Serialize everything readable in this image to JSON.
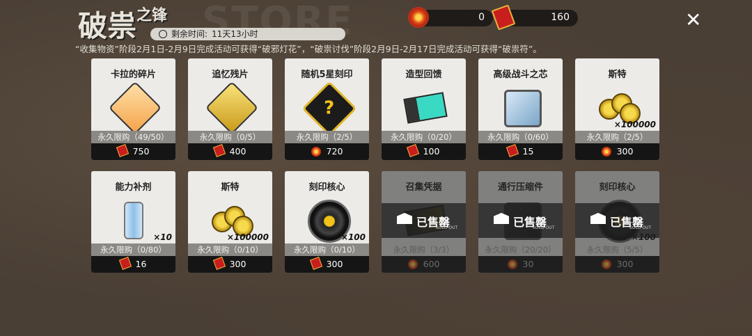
{
  "header": {
    "bg_word": "STORE",
    "title_main": "破祟",
    "title_small": "之锋",
    "timer_label": "剩余时间:",
    "timer_value": "11天13小时",
    "notice": "“收集物资”阶段2月1日-2月9日完成活动可获得“破邪灯花”，“破祟讨伐”阶段2月9日-2月17日完成活动可获得“破祟符”。"
  },
  "currency": [
    {
      "name": "破邪灯花",
      "icon": "flower-icon",
      "value": "0"
    },
    {
      "name": "破祟符",
      "icon": "talisman-icon",
      "value": "160"
    }
  ],
  "close_label": "✕",
  "colors": {
    "talisman": "#c81e1e",
    "flower": "#e04a1a",
    "card_bg": "#ecebe8"
  },
  "items": [
    {
      "name": "卡拉的碎片",
      "limit": "永久限购（49/50）",
      "price": "750",
      "currency": "talisman",
      "qty": "",
      "sold": false,
      "art": "portrait-shard"
    },
    {
      "name": "追忆残片",
      "limit": "永久限购（0/5）",
      "price": "400",
      "currency": "talisman",
      "qty": "",
      "sold": false,
      "art": "gold-shard"
    },
    {
      "name": "随机5星刻印",
      "limit": "永久限购（2/5）",
      "price": "720",
      "currency": "flower",
      "qty": "",
      "sold": false,
      "art": "mystery-seal"
    },
    {
      "name": "造型回馈",
      "limit": "永久限购（0/20）",
      "price": "100",
      "currency": "talisman",
      "qty": "",
      "sold": false,
      "art": "ticket"
    },
    {
      "name": "高级战斗之芯",
      "limit": "永久限购（0/60）",
      "price": "15",
      "currency": "talisman",
      "qty": "",
      "sold": false,
      "art": "crystal-cube"
    },
    {
      "name": "斯特",
      "limit": "永久限购（2/5）",
      "price": "300",
      "currency": "flower",
      "qty": "×100000",
      "sold": false,
      "art": "coins"
    },
    {
      "name": "能力补剂",
      "limit": "永久限购（0/80）",
      "price": "16",
      "currency": "talisman",
      "qty": "×10",
      "sold": false,
      "art": "vial"
    },
    {
      "name": "斯特",
      "limit": "永久限购（0/10）",
      "price": "300",
      "currency": "talisman",
      "qty": "×100000",
      "sold": false,
      "art": "coins"
    },
    {
      "name": "刻印核心",
      "limit": "永久限购（0/10）",
      "price": "300",
      "currency": "talisman",
      "qty": "×100",
      "sold": false,
      "art": "core"
    },
    {
      "name": "召集凭据",
      "limit": "永久限购（3/3）",
      "price": "600",
      "currency": "flower",
      "qty": "",
      "sold": true,
      "art": "voucher"
    },
    {
      "name": "通行压缩件",
      "limit": "永久限购（20/20）",
      "price": "30",
      "currency": "flower",
      "qty": "",
      "sold": true,
      "art": "device"
    },
    {
      "name": "刻印核心",
      "limit": "永久限购（5/5）",
      "price": "300",
      "currency": "flower",
      "qty": "×100",
      "sold": true,
      "art": "core"
    }
  ],
  "sold_label": "已售罄",
  "sold_sub": "SOLD OUT"
}
